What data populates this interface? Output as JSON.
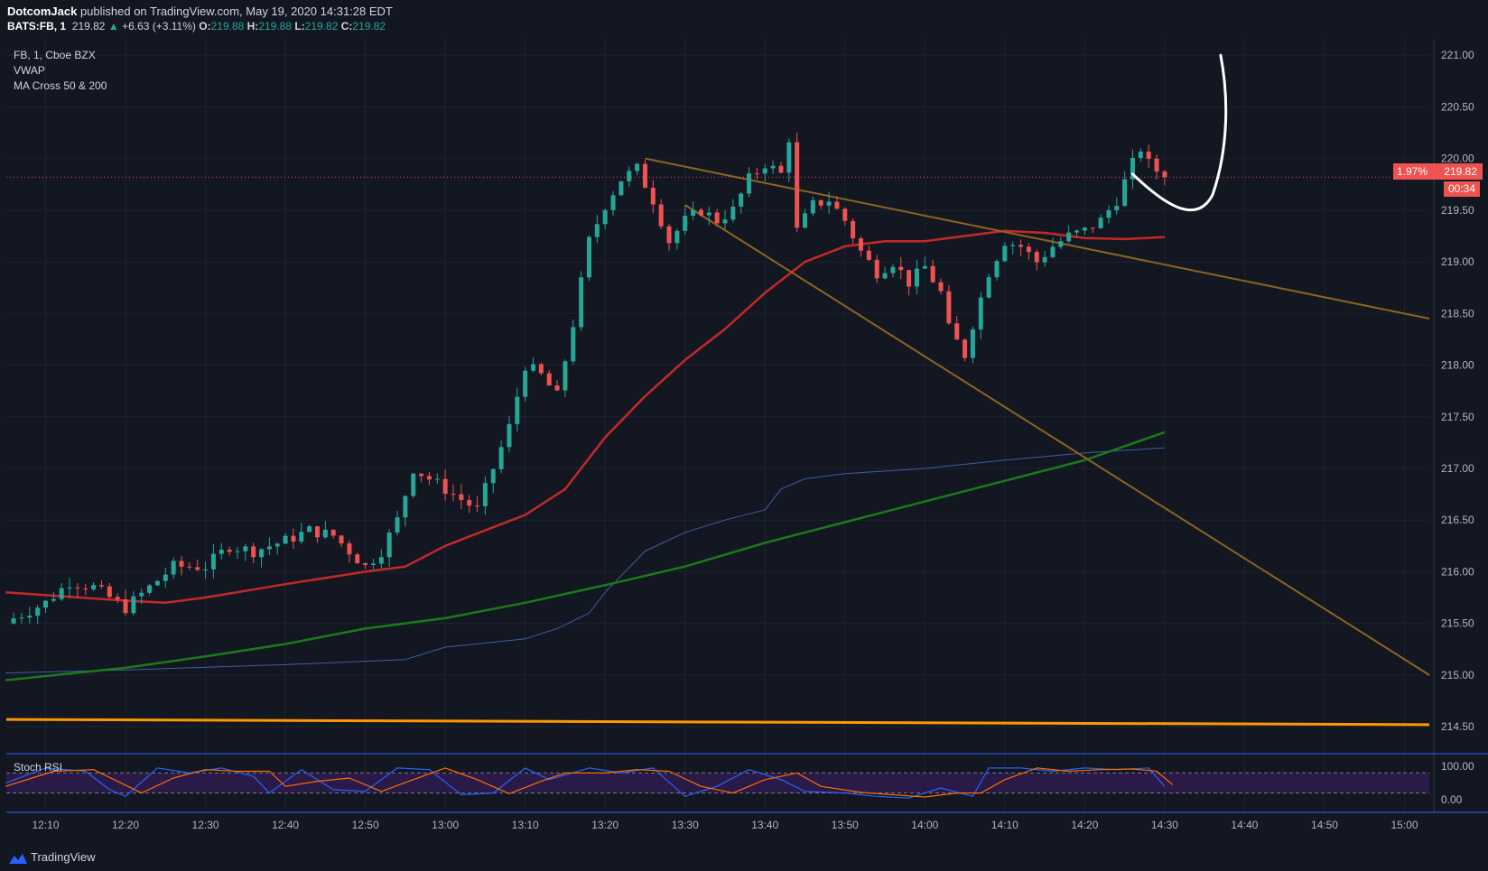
{
  "header": {
    "author": "DotcomJack",
    "published": "published on TradingView.com, May 19, 2020 14:31:28 EDT",
    "symbol": "BATS:FB, 1",
    "last": "219.82",
    "change": "+6.63 (+3.11%)",
    "o_label": "O:",
    "o_value": "219.88",
    "h_label": "H:",
    "h_value": "219.88",
    "l_label": "L:",
    "l_value": "219.82",
    "c_label": "C:",
    "c_value": "219.82"
  },
  "legend": {
    "line1": "FB, 1, Cboe BZX",
    "line2": "VWAP",
    "line3": "MA Cross 50 & 200"
  },
  "badge": {
    "pct": "1.97%",
    "price": "219.82",
    "countdown": "00:34"
  },
  "footer": {
    "brand": "TradingView"
  },
  "colors": {
    "up": "#26a69a",
    "down": "#ef5350",
    "ma50": "#c62828",
    "ma200": "#1b7a1b",
    "vwap": "#3d5ea6",
    "trend": "#8f6321",
    "support": "#ff9800",
    "rsi_k": "#2962ff",
    "rsi_d": "#ff6d00",
    "background": "#131722"
  },
  "chart_data": [
    {
      "type": "candlestick",
      "ylim": [
        214.3,
        221.15
      ],
      "y_ticks": [
        "221.00",
        "220.50",
        "220.00",
        "219.50",
        "219.00",
        "218.50",
        "218.00",
        "217.50",
        "217.00",
        "216.50",
        "216.00",
        "215.50",
        "215.00",
        "214.50"
      ],
      "x_ticks": [
        "12:10",
        "12:20",
        "12:30",
        "12:40",
        "12:50",
        "13:00",
        "13:10",
        "13:20",
        "13:30",
        "13:40",
        "13:50",
        "14:00",
        "14:10",
        "14:20",
        "14:30",
        "14:40",
        "14:50",
        "15:00"
      ],
      "anchors": [
        [
          "12:06",
          215.55
        ],
        [
          "12:10",
          215.7
        ],
        [
          "12:13",
          215.9
        ],
        [
          "12:16",
          215.85
        ],
        [
          "12:20",
          215.65
        ],
        [
          "12:23",
          215.85
        ],
        [
          "12:26",
          216.05
        ],
        [
          "12:30",
          216.05
        ],
        [
          "12:33",
          216.25
        ],
        [
          "12:36",
          216.2
        ],
        [
          "12:40",
          216.3
        ],
        [
          "12:43",
          216.4
        ],
        [
          "12:46",
          216.35
        ],
        [
          "12:48",
          216.2
        ],
        [
          "12:50",
          216.05
        ],
        [
          "12:52",
          216.2
        ],
        [
          "12:54",
          216.5
        ],
        [
          "12:56",
          217.0
        ],
        [
          "12:58",
          216.9
        ],
        [
          "13:00",
          216.8
        ],
        [
          "13:02",
          216.7
        ],
        [
          "13:04",
          216.6
        ],
        [
          "13:06",
          217.0
        ],
        [
          "13:08",
          217.4
        ],
        [
          "13:10",
          218.0
        ],
        [
          "13:12",
          217.9
        ],
        [
          "13:14",
          217.7
        ],
        [
          "13:16",
          218.4
        ],
        [
          "13:18",
          219.2
        ],
        [
          "13:20",
          219.55
        ],
        [
          "13:22",
          219.8
        ],
        [
          "13:24",
          219.9
        ],
        [
          "13:26",
          219.6
        ],
        [
          "13:28",
          219.2
        ],
        [
          "13:30",
          219.4
        ],
        [
          "13:32",
          219.5
        ],
        [
          "13:34",
          219.4
        ],
        [
          "13:36",
          219.5
        ],
        [
          "13:38",
          219.8
        ],
        [
          "13:40",
          219.95
        ],
        [
          "13:42",
          219.85
        ],
        [
          "13:43",
          220.2
        ],
        [
          "13:44",
          219.3
        ],
        [
          "13:46",
          219.55
        ],
        [
          "13:48",
          219.6
        ],
        [
          "13:50",
          219.4
        ],
        [
          "13:52",
          219.1
        ],
        [
          "13:54",
          218.9
        ],
        [
          "13:56",
          219.0
        ],
        [
          "13:58",
          218.8
        ],
        [
          "14:00",
          218.95
        ],
        [
          "14:02",
          218.7
        ],
        [
          "14:03",
          218.35
        ],
        [
          "14:05",
          218.1
        ],
        [
          "14:06",
          218.4
        ],
        [
          "14:08",
          218.9
        ],
        [
          "14:10",
          219.2
        ],
        [
          "14:12",
          219.15
        ],
        [
          "14:14",
          219.0
        ],
        [
          "14:16",
          219.15
        ],
        [
          "14:18",
          219.25
        ],
        [
          "14:20",
          219.3
        ],
        [
          "14:22",
          219.4
        ],
        [
          "14:24",
          219.6
        ],
        [
          "14:26",
          219.95
        ],
        [
          "14:27",
          220.1
        ],
        [
          "14:28",
          219.95
        ],
        [
          "14:30",
          219.82
        ]
      ]
    },
    {
      "type": "line",
      "series": [
        {
          "key": "ma50",
          "x": [
            "12:05",
            "12:20",
            "12:25",
            "12:30",
            "12:40",
            "12:50",
            "12:55",
            "13:00",
            "13:05",
            "13:10",
            "13:15",
            "13:20",
            "13:25",
            "13:30",
            "13:35",
            "13:40",
            "13:45",
            "13:50",
            "13:55",
            "14:00",
            "14:05",
            "14:10",
            "14:15",
            "14:20",
            "14:25",
            "14:30"
          ],
          "values": [
            215.8,
            215.72,
            215.7,
            215.75,
            215.88,
            216.0,
            216.05,
            216.25,
            216.4,
            216.55,
            216.8,
            217.3,
            217.7,
            218.05,
            218.35,
            218.7,
            219.0,
            219.15,
            219.2,
            219.2,
            219.25,
            219.3,
            219.28,
            219.23,
            219.22,
            219.24
          ]
        },
        {
          "key": "ma200",
          "x": [
            "12:05",
            "12:20",
            "12:30",
            "12:40",
            "12:50",
            "13:00",
            "13:10",
            "13:20",
            "13:30",
            "13:40",
            "13:50",
            "14:00",
            "14:10",
            "14:20",
            "14:30"
          ],
          "values": [
            214.95,
            215.07,
            215.18,
            215.3,
            215.45,
            215.55,
            215.7,
            215.87,
            216.05,
            216.28,
            216.48,
            216.68,
            216.88,
            217.08,
            217.35
          ]
        },
        {
          "key": "vwap",
          "x": [
            "12:05",
            "12:20",
            "12:40",
            "12:55",
            "13:00",
            "13:10",
            "13:14",
            "13:18",
            "13:20",
            "13:25",
            "13:30",
            "13:35",
            "13:40",
            "13:42",
            "13:45",
            "13:50",
            "14:00",
            "14:10",
            "14:20",
            "14:30"
          ],
          "values": [
            215.02,
            215.05,
            215.1,
            215.15,
            215.27,
            215.35,
            215.45,
            215.6,
            215.8,
            216.2,
            216.38,
            216.5,
            216.6,
            216.8,
            216.9,
            216.95,
            217.0,
            217.08,
            217.15,
            217.2
          ]
        }
      ]
    },
    {
      "type": "area",
      "title": "Stoch RSI",
      "ylim": [
        0,
        100
      ],
      "y_ticks": [
        "100.00",
        "0.00"
      ],
      "bands": [
        80,
        20
      ],
      "k_x": [
        "12:05",
        "12:10",
        "12:15",
        "12:18",
        "12:20",
        "12:24",
        "12:28",
        "12:32",
        "12:36",
        "12:38",
        "12:42",
        "12:46",
        "12:50",
        "12:54",
        "12:58",
        "13:02",
        "13:06",
        "13:10",
        "13:13",
        "13:18",
        "13:22",
        "13:26",
        "13:30",
        "13:34",
        "13:38",
        "13:42",
        "13:45",
        "13:50",
        "13:54",
        "13:58",
        "14:02",
        "14:06",
        "14:08",
        "14:12",
        "14:16",
        "14:20",
        "14:24",
        "14:28",
        "14:30"
      ],
      "k": [
        50,
        95,
        85,
        30,
        10,
        95,
        80,
        95,
        70,
        20,
        90,
        30,
        25,
        95,
        90,
        15,
        20,
        95,
        60,
        95,
        80,
        95,
        10,
        40,
        90,
        60,
        25,
        20,
        10,
        5,
        35,
        10,
        95,
        95,
        85,
        95,
        90,
        95,
        40
      ],
      "d_x": [
        "12:05",
        "12:11",
        "12:16",
        "12:19",
        "12:22",
        "12:26",
        "12:30",
        "12:34",
        "12:38",
        "12:40",
        "12:44",
        "12:48",
        "12:52",
        "12:56",
        "13:00",
        "13:04",
        "13:08",
        "13:12",
        "13:15",
        "13:20",
        "13:24",
        "13:28",
        "13:32",
        "13:36",
        "13:40",
        "13:44",
        "13:47",
        "13:52",
        "13:56",
        "14:00",
        "14:04",
        "14:07",
        "14:10",
        "14:14",
        "14:18",
        "14:22",
        "14:26",
        "14:29",
        "14:31"
      ],
      "d": [
        40,
        85,
        90,
        55,
        20,
        65,
        90,
        85,
        85,
        40,
        55,
        65,
        25,
        60,
        95,
        60,
        18,
        55,
        80,
        80,
        90,
        85,
        40,
        20,
        60,
        80,
        40,
        22,
        15,
        8,
        20,
        20,
        60,
        95,
        85,
        90,
        92,
        85,
        45
      ]
    }
  ]
}
